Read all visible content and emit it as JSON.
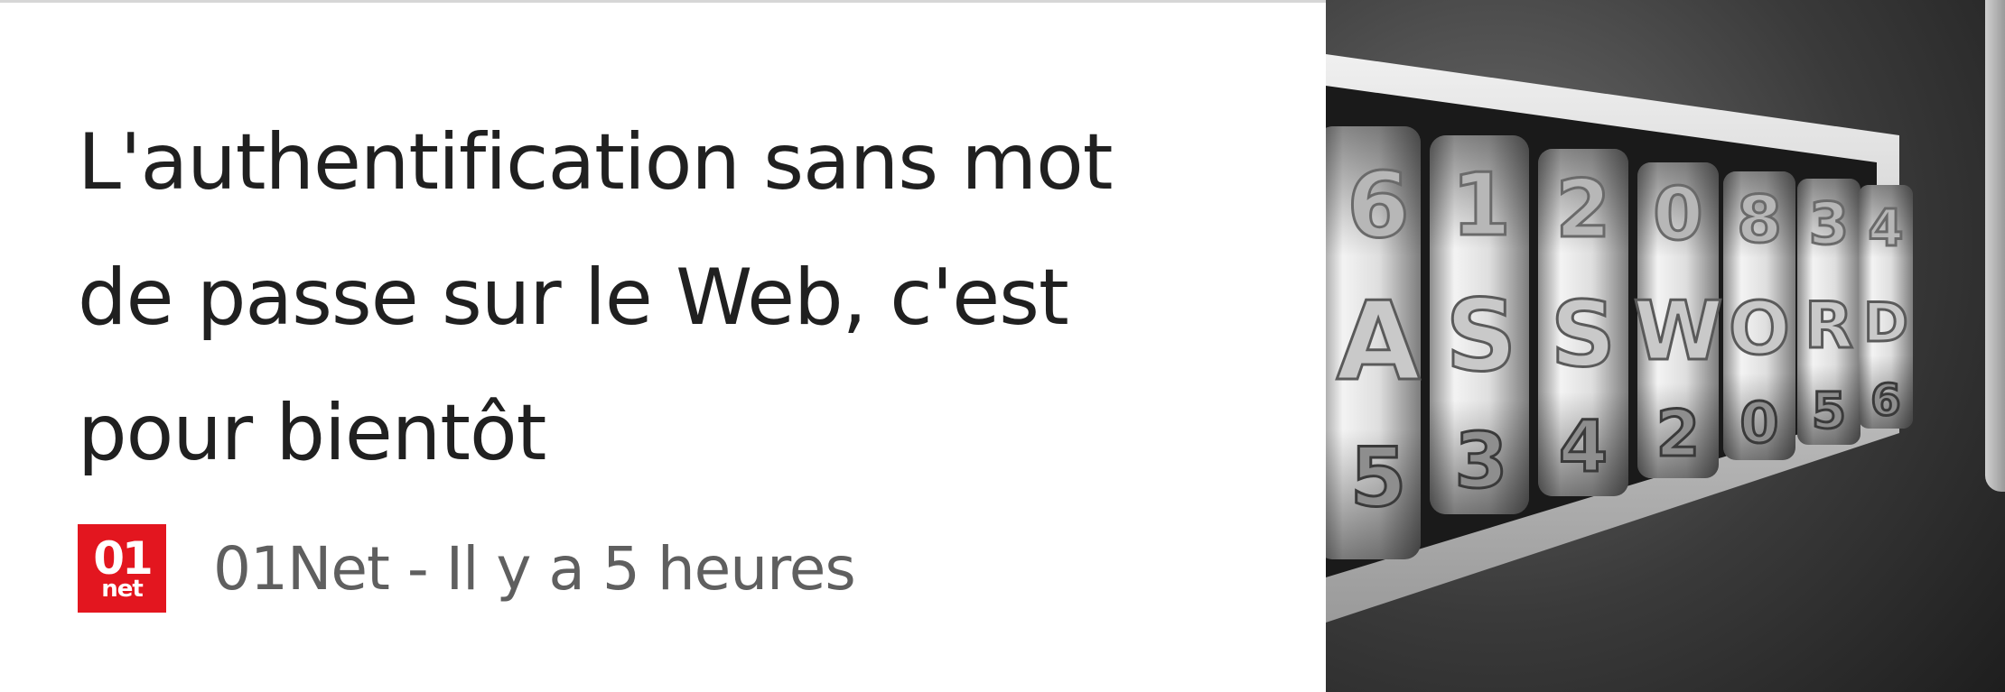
{
  "article": {
    "headline": "L'authentification sans mot de passe sur le Web, c'est pour bientôt",
    "source": {
      "logo_top": "01",
      "logo_bottom": "net",
      "meta": "01Net - Il y a 5 heures"
    }
  },
  "thumbnail": {
    "top_row": [
      "6",
      "1",
      "2",
      "0",
      "8",
      "3",
      "4"
    ],
    "middle_row": [
      "A",
      "S",
      "S",
      "W",
      "O",
      "R",
      "D"
    ],
    "bottom_row": [
      "5",
      "3",
      "4",
      "2",
      "0",
      "5",
      "6"
    ]
  },
  "colors": {
    "source_brand": "#e3161f",
    "headline_text": "#202020",
    "meta_text": "#5f5f5f"
  }
}
